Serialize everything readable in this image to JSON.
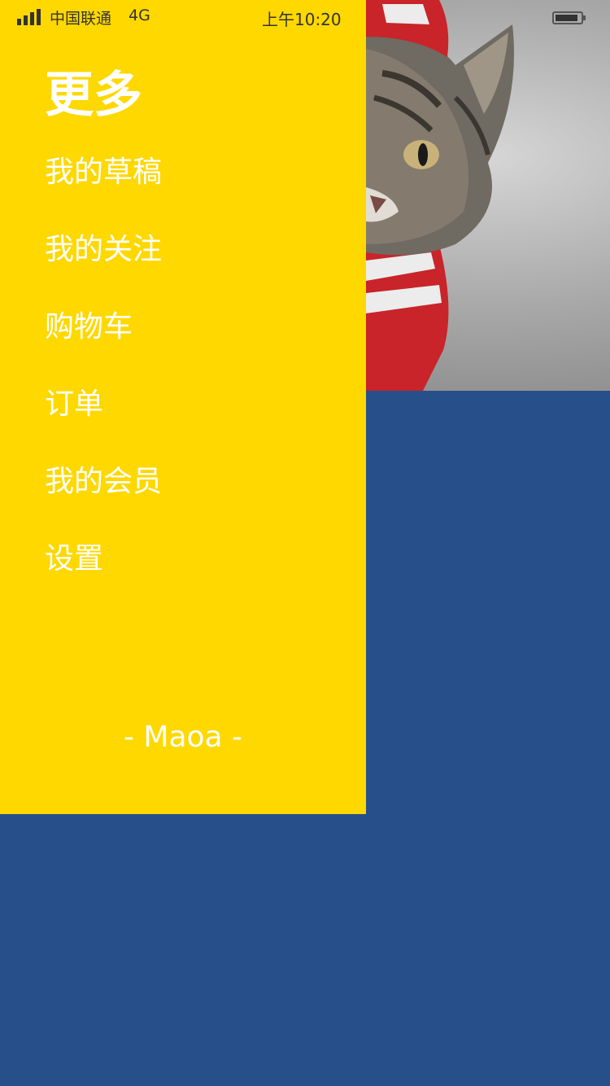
{
  "status_bar": {
    "carrier": "中国联通",
    "network": "4G",
    "time": "上午10:20",
    "icons": [
      "signal-icon",
      "battery-icon"
    ]
  },
  "drawer": {
    "title": "更多",
    "items": [
      {
        "label": "我的草稿"
      },
      {
        "label": "我的关注"
      },
      {
        "label": "购物车"
      },
      {
        "label": "订单"
      },
      {
        "label": "我的会员"
      },
      {
        "label": "设置"
      }
    ],
    "footer": "- Maoa -"
  },
  "colors": {
    "drawer_bg": "#ffd800",
    "content_bg": "#27508a",
    "text": "#ffffff"
  }
}
